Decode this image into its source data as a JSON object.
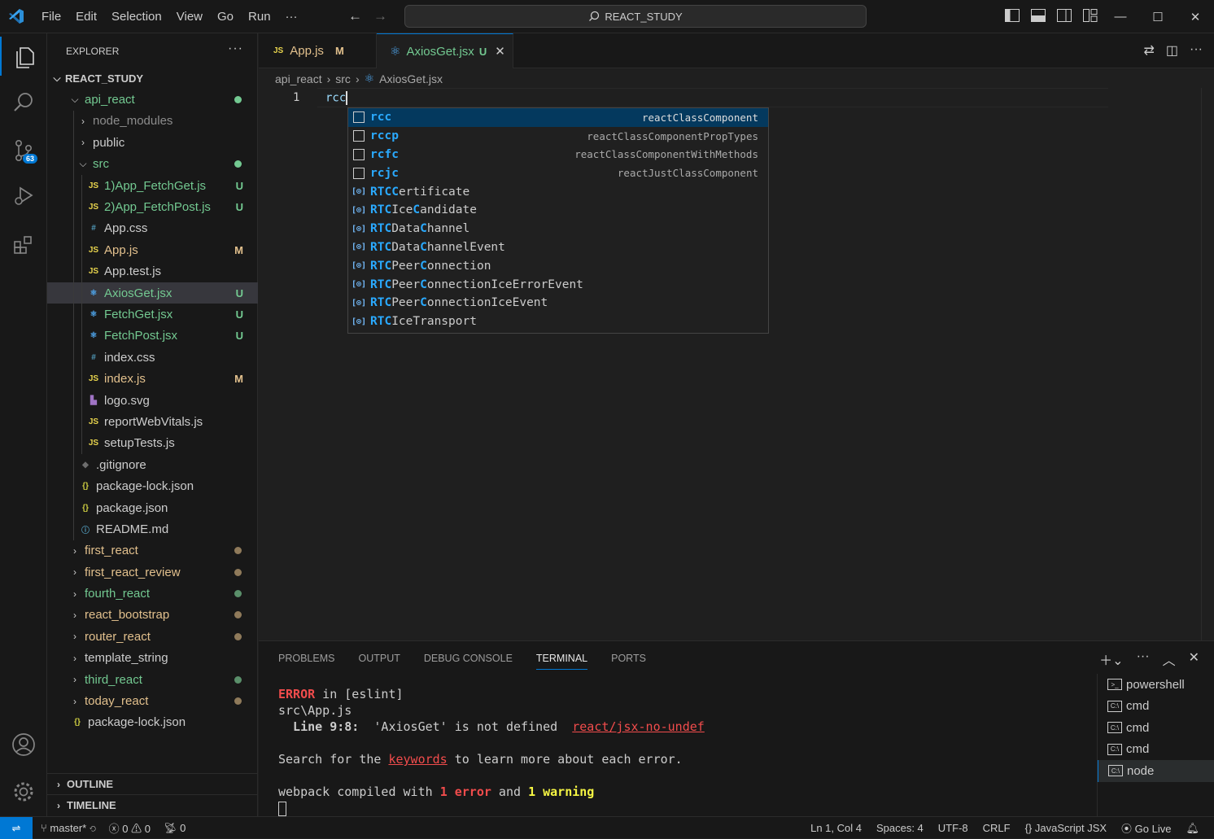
{
  "window": {
    "search_text": "REACT_STUDY"
  },
  "menu": [
    "File",
    "Edit",
    "Selection",
    "View",
    "Go",
    "Run",
    "···"
  ],
  "activity": {
    "scm_badge": "63"
  },
  "explorer": {
    "title": "EXPLORER",
    "root": "REACT_STUDY",
    "items": [
      {
        "label": "api_react",
        "indent": 1,
        "kind": "folder-open",
        "color": "green",
        "dot": "#73c991"
      },
      {
        "label": "node_modules",
        "indent": 2,
        "kind": "folder",
        "color": "gray"
      },
      {
        "label": "public",
        "indent": 2,
        "kind": "folder",
        "color": "white"
      },
      {
        "label": "src",
        "indent": 2,
        "kind": "folder-open",
        "color": "green",
        "dot": "#73c991"
      },
      {
        "label": "1)App_FetchGet.js",
        "indent": 3,
        "icon": "JS",
        "color": "green",
        "status": "U"
      },
      {
        "label": "2)App_FetchPost.js",
        "indent": 3,
        "icon": "JS",
        "color": "green",
        "status": "U"
      },
      {
        "label": "App.css",
        "indent": 3,
        "icon": "#",
        "color": "white"
      },
      {
        "label": "App.js",
        "indent": 3,
        "icon": "JS",
        "color": "yellow",
        "status": "M"
      },
      {
        "label": "App.test.js",
        "indent": 3,
        "icon": "JS",
        "color": "white"
      },
      {
        "label": "AxiosGet.jsx",
        "indent": 3,
        "icon": "⚛",
        "color": "green",
        "status": "U",
        "selected": true
      },
      {
        "label": "FetchGet.jsx",
        "indent": 3,
        "icon": "⚛",
        "color": "green",
        "status": "U"
      },
      {
        "label": "FetchPost.jsx",
        "indent": 3,
        "icon": "⚛",
        "color": "green",
        "status": "U"
      },
      {
        "label": "index.css",
        "indent": 3,
        "icon": "#",
        "color": "white"
      },
      {
        "label": "index.js",
        "indent": 3,
        "icon": "JS",
        "color": "yellow",
        "status": "M"
      },
      {
        "label": "logo.svg",
        "indent": 3,
        "icon": "▙",
        "color": "white"
      },
      {
        "label": "reportWebVitals.js",
        "indent": 3,
        "icon": "JS",
        "color": "white"
      },
      {
        "label": "setupTests.js",
        "indent": 3,
        "icon": "JS",
        "color": "white"
      },
      {
        "label": ".gitignore",
        "indent": 2,
        "icon": "◆",
        "color": "white"
      },
      {
        "label": "package-lock.json",
        "indent": 2,
        "icon": "{}",
        "color": "white"
      },
      {
        "label": "package.json",
        "indent": 2,
        "icon": "{}",
        "color": "white"
      },
      {
        "label": "README.md",
        "indent": 2,
        "icon": "ⓘ",
        "color": "white"
      },
      {
        "label": "first_react",
        "indent": 1,
        "kind": "folder",
        "color": "yellow",
        "dot": "#8f7a5a"
      },
      {
        "label": "first_react_review",
        "indent": 1,
        "kind": "folder",
        "color": "yellow",
        "dot": "#8f7a5a"
      },
      {
        "label": "fourth_react",
        "indent": 1,
        "kind": "folder",
        "color": "green",
        "dot": "#5a8f6a"
      },
      {
        "label": "react_bootstrap",
        "indent": 1,
        "kind": "folder",
        "color": "yellow",
        "dot": "#8f7a5a"
      },
      {
        "label": "router_react",
        "indent": 1,
        "kind": "folder",
        "color": "yellow",
        "dot": "#8f7a5a"
      },
      {
        "label": "template_string",
        "indent": 1,
        "kind": "folder",
        "color": "white"
      },
      {
        "label": "third_react",
        "indent": 1,
        "kind": "folder",
        "color": "green",
        "dot": "#5a8f6a"
      },
      {
        "label": "today_react",
        "indent": 1,
        "kind": "folder",
        "color": "yellow",
        "dot": "#8f7a5a"
      },
      {
        "label": "package-lock.json",
        "indent": 1,
        "icon": "{}",
        "color": "white"
      }
    ],
    "outline": "OUTLINE",
    "timeline": "TIMELINE"
  },
  "tabs": [
    {
      "label": "App.js",
      "status": "M"
    },
    {
      "label": "AxiosGet.jsx",
      "status": "U"
    }
  ],
  "breadcrumb": [
    "api_react",
    "src",
    "AxiosGet.jsx"
  ],
  "editor": {
    "line_number": "1",
    "text": "rcc"
  },
  "suggestions": [
    {
      "pre": "",
      "hl": "rcc",
      "post": "",
      "detail": "reactClassComponent",
      "kind": "snippet"
    },
    {
      "pre": "",
      "hl": "rcc",
      "post": "p",
      "detail": "reactClassComponentPropTypes",
      "kind": "snippet"
    },
    {
      "pre": "",
      "hl": "rc",
      "post": "",
      "hl2": "c",
      "tail": "",
      "mid": "f",
      "detail": "reactClassComponentWithMethods",
      "kind": "snippet"
    },
    {
      "pre": "",
      "hl": "rc",
      "post": "",
      "hl2": "c",
      "tail": "",
      "mid": "j",
      "detail": "reactJustClassComponent",
      "kind": "snippet"
    },
    {
      "label": "RTCCertificate",
      "kind": "symbol"
    },
    {
      "label": "RTCIceCandidate",
      "kind": "symbol"
    },
    {
      "label": "RTCDataChannel",
      "kind": "symbol"
    },
    {
      "label": "RTCDataChannelEvent",
      "kind": "symbol"
    },
    {
      "label": "RTCPeerConnection",
      "kind": "symbol"
    },
    {
      "label": "RTCPeerConnectionIceErrorEvent",
      "kind": "symbol"
    },
    {
      "label": "RTCPeerConnectionIceEvent",
      "kind": "symbol"
    },
    {
      "label": "RTCIceTransport",
      "kind": "symbol"
    }
  ],
  "panel": {
    "tabs": [
      "PROBLEMS",
      "OUTPUT",
      "DEBUG CONSOLE",
      "TERMINAL",
      "PORTS"
    ],
    "active_tab": "TERMINAL",
    "terminal": {
      "l1_error": "ERROR",
      "l1_rest": " in [eslint]",
      "l2": "src\\App.js",
      "l3_pos": "  Line 9:8:",
      "l3_msg": "  'AxiosGet' is not defined  ",
      "l3_rule": "react/jsx-no-undef",
      "l5_a": "Search for the ",
      "l5_link": "keywords",
      "l5_b": " to learn more about each error.",
      "l7_a": "webpack compiled with ",
      "l7_err": "1 error",
      "l7_b": " and ",
      "l7_warn": "1 warning"
    },
    "terminals": [
      "powershell",
      "cmd",
      "cmd",
      "cmd",
      "node"
    ]
  },
  "status": {
    "branch": "master*",
    "errors": "0",
    "warnings": "0",
    "ports": "0",
    "position": "Ln 1, Col 4",
    "spaces": "Spaces: 4",
    "encoding": "UTF-8",
    "eol": "CRLF",
    "language": "JavaScript JSX",
    "golive": "Go Live"
  }
}
